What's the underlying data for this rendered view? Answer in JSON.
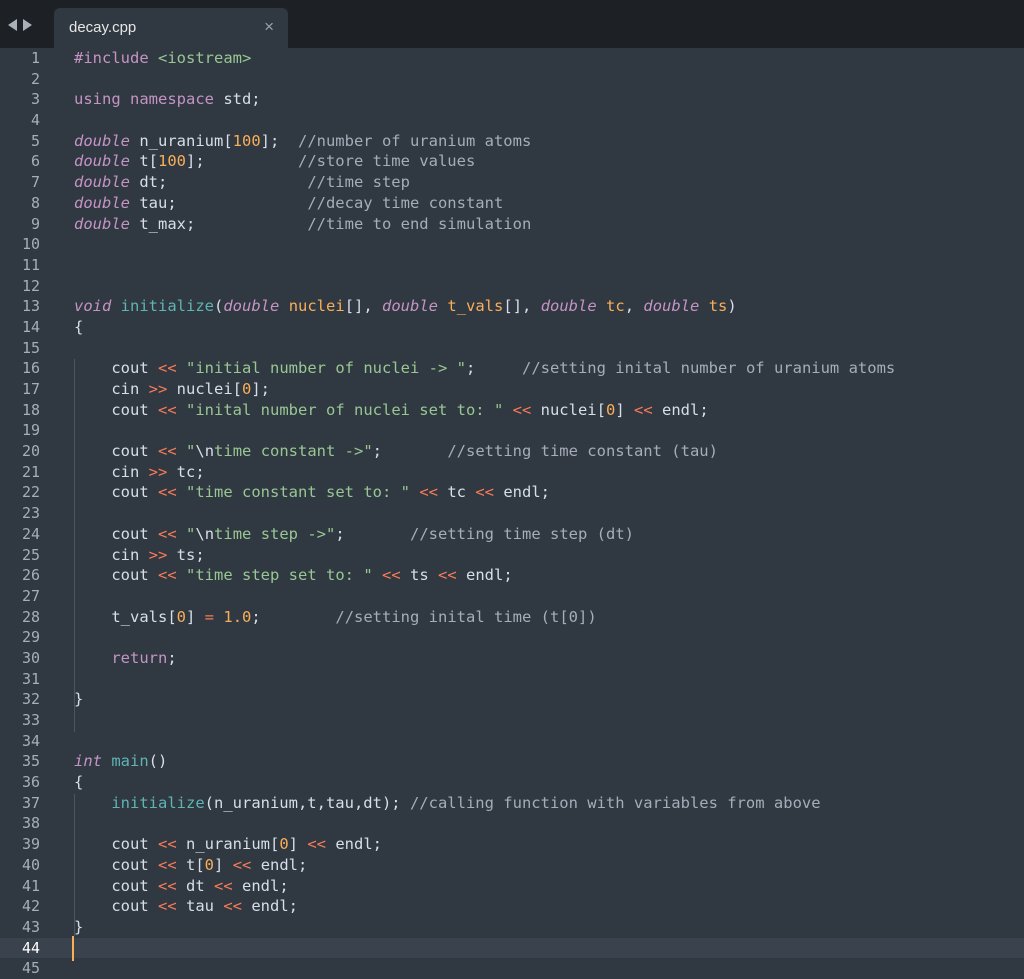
{
  "tab": {
    "title": "decay.cpp"
  },
  "line_numbers": [
    "1",
    "2",
    "3",
    "4",
    "5",
    "6",
    "7",
    "8",
    "9",
    "10",
    "11",
    "12",
    "13",
    "14",
    "15",
    "16",
    "17",
    "18",
    "19",
    "20",
    "21",
    "22",
    "23",
    "24",
    "25",
    "26",
    "27",
    "28",
    "29",
    "30",
    "31",
    "32",
    "33",
    "34",
    "35",
    "36",
    "37",
    "38",
    "39",
    "40",
    "41",
    "42",
    "43",
    "44",
    "45"
  ],
  "current_line": 44,
  "code": [
    [
      [
        "k",
        "#include"
      ],
      [
        "d",
        " "
      ],
      [
        "s",
        "<iostream>"
      ]
    ],
    [],
    [
      [
        "k",
        "using namespace"
      ],
      [
        "d",
        " std;"
      ]
    ],
    [],
    [
      [
        "t",
        "double"
      ],
      [
        "d",
        " n_uranium["
      ],
      [
        "n",
        "100"
      ],
      [
        "d",
        "];  "
      ],
      [
        "c",
        "//number of uranium atoms"
      ]
    ],
    [
      [
        "t",
        "double"
      ],
      [
        "d",
        " t["
      ],
      [
        "n",
        "100"
      ],
      [
        "d",
        "];          "
      ],
      [
        "c",
        "//store time values"
      ]
    ],
    [
      [
        "t",
        "double"
      ],
      [
        "d",
        " dt;               "
      ],
      [
        "c",
        "//time step"
      ]
    ],
    [
      [
        "t",
        "double"
      ],
      [
        "d",
        " tau;              "
      ],
      [
        "c",
        "//decay time constant"
      ]
    ],
    [
      [
        "t",
        "double"
      ],
      [
        "d",
        " t_max;            "
      ],
      [
        "c",
        "//time to end simulation"
      ]
    ],
    [],
    [],
    [],
    [
      [
        "t",
        "void"
      ],
      [
        "d",
        " "
      ],
      [
        "fn",
        "initialize"
      ],
      [
        "d",
        "("
      ],
      [
        "t",
        "double"
      ],
      [
        "d",
        " "
      ],
      [
        "p",
        "nuclei"
      ],
      [
        "d",
        "[], "
      ],
      [
        "t",
        "double"
      ],
      [
        "d",
        " "
      ],
      [
        "p",
        "t_vals"
      ],
      [
        "d",
        "[], "
      ],
      [
        "t",
        "double"
      ],
      [
        "d",
        " "
      ],
      [
        "p",
        "tc"
      ],
      [
        "d",
        ", "
      ],
      [
        "t",
        "double"
      ],
      [
        "d",
        " "
      ],
      [
        "p",
        "ts"
      ],
      [
        "d",
        ")"
      ]
    ],
    [
      [
        "d",
        "{"
      ]
    ],
    [],
    [
      [
        "d",
        "    cout "
      ],
      [
        "op",
        "<<"
      ],
      [
        "d",
        " "
      ],
      [
        "s",
        "\"initial number of nuclei -> \""
      ],
      [
        "d",
        ";     "
      ],
      [
        "c",
        "//setting inital number of uranium atoms"
      ]
    ],
    [
      [
        "d",
        "    cin "
      ],
      [
        "op",
        ">>"
      ],
      [
        "d",
        " nuclei["
      ],
      [
        "n",
        "0"
      ],
      [
        "d",
        "];"
      ]
    ],
    [
      [
        "d",
        "    cout "
      ],
      [
        "op",
        "<<"
      ],
      [
        "d",
        " "
      ],
      [
        "s",
        "\"inital number of nuclei set to: \""
      ],
      [
        "d",
        " "
      ],
      [
        "op",
        "<<"
      ],
      [
        "d",
        " nuclei["
      ],
      [
        "n",
        "0"
      ],
      [
        "d",
        "] "
      ],
      [
        "op",
        "<<"
      ],
      [
        "d",
        " endl;"
      ]
    ],
    [],
    [
      [
        "d",
        "    cout "
      ],
      [
        "op",
        "<<"
      ],
      [
        "d",
        " "
      ],
      [
        "s",
        "\""
      ],
      [
        "d",
        "\\n"
      ],
      [
        "s",
        "time constant ->\""
      ],
      [
        "d",
        ";       "
      ],
      [
        "c",
        "//setting time constant (tau)"
      ]
    ],
    [
      [
        "d",
        "    cin "
      ],
      [
        "op",
        ">>"
      ],
      [
        "d",
        " tc;"
      ]
    ],
    [
      [
        "d",
        "    cout "
      ],
      [
        "op",
        "<<"
      ],
      [
        "d",
        " "
      ],
      [
        "s",
        "\"time constant set to: \""
      ],
      [
        "d",
        " "
      ],
      [
        "op",
        "<<"
      ],
      [
        "d",
        " tc "
      ],
      [
        "op",
        "<<"
      ],
      [
        "d",
        " endl;"
      ]
    ],
    [],
    [
      [
        "d",
        "    cout "
      ],
      [
        "op",
        "<<"
      ],
      [
        "d",
        " "
      ],
      [
        "s",
        "\""
      ],
      [
        "d",
        "\\n"
      ],
      [
        "s",
        "time step ->\""
      ],
      [
        "d",
        ";       "
      ],
      [
        "c",
        "//setting time step (dt)"
      ]
    ],
    [
      [
        "d",
        "    cin "
      ],
      [
        "op",
        ">>"
      ],
      [
        "d",
        " ts;"
      ]
    ],
    [
      [
        "d",
        "    cout "
      ],
      [
        "op",
        "<<"
      ],
      [
        "d",
        " "
      ],
      [
        "s",
        "\"time step set to: \""
      ],
      [
        "d",
        " "
      ],
      [
        "op",
        "<<"
      ],
      [
        "d",
        " ts "
      ],
      [
        "op",
        "<<"
      ],
      [
        "d",
        " endl;"
      ]
    ],
    [],
    [
      [
        "d",
        "    t_vals["
      ],
      [
        "n",
        "0"
      ],
      [
        "d",
        "] "
      ],
      [
        "op",
        "="
      ],
      [
        "d",
        " "
      ],
      [
        "n",
        "1.0"
      ],
      [
        "d",
        ";        "
      ],
      [
        "c",
        "//setting inital time (t[0])"
      ]
    ],
    [],
    [
      [
        "k",
        "    return"
      ],
      [
        "d",
        ";"
      ]
    ],
    [],
    [
      [
        "d",
        "}"
      ]
    ],
    [],
    [],
    [
      [
        "t",
        "int"
      ],
      [
        "d",
        " "
      ],
      [
        "fn",
        "main"
      ],
      [
        "d",
        "()"
      ]
    ],
    [
      [
        "d",
        "{"
      ]
    ],
    [
      [
        "d",
        "    "
      ],
      [
        "fn",
        "initialize"
      ],
      [
        "d",
        "(n_uranium,t,tau,dt); "
      ],
      [
        "c",
        "//calling function with variables from above"
      ]
    ],
    [],
    [
      [
        "d",
        "    cout "
      ],
      [
        "op",
        "<<"
      ],
      [
        "d",
        " n_uranium["
      ],
      [
        "n",
        "0"
      ],
      [
        "d",
        "] "
      ],
      [
        "op",
        "<<"
      ],
      [
        "d",
        " endl;"
      ]
    ],
    [
      [
        "d",
        "    cout "
      ],
      [
        "op",
        "<<"
      ],
      [
        "d",
        " t["
      ],
      [
        "n",
        "0"
      ],
      [
        "d",
        "] "
      ],
      [
        "op",
        "<<"
      ],
      [
        "d",
        " endl;"
      ]
    ],
    [
      [
        "d",
        "    cout "
      ],
      [
        "op",
        "<<"
      ],
      [
        "d",
        " dt "
      ],
      [
        "op",
        "<<"
      ],
      [
        "d",
        " endl;"
      ]
    ],
    [
      [
        "d",
        "    cout "
      ],
      [
        "op",
        "<<"
      ],
      [
        "d",
        " tau "
      ],
      [
        "op",
        "<<"
      ],
      [
        "d",
        " endl;"
      ]
    ],
    [
      [
        "d",
        "}"
      ]
    ],
    [],
    []
  ]
}
